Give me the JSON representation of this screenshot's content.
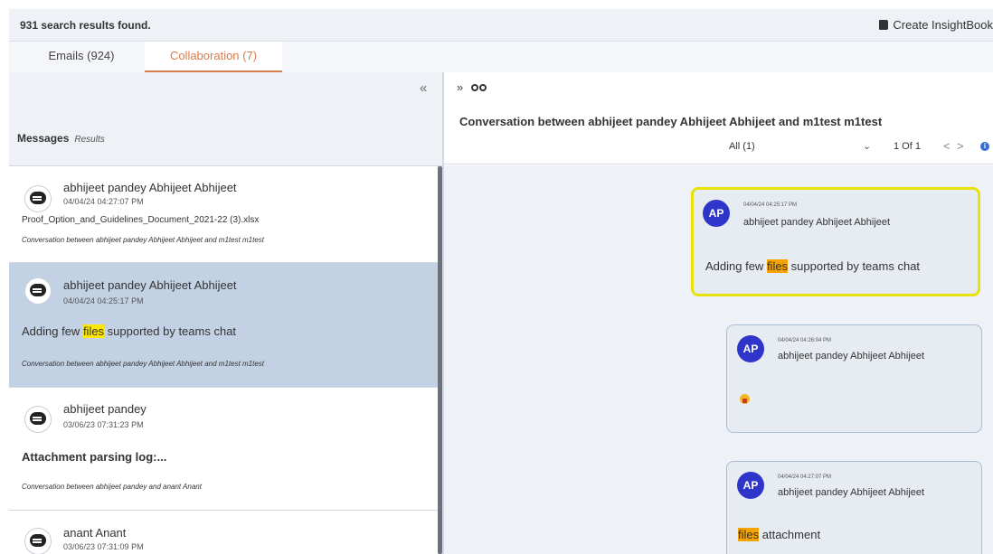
{
  "header": {
    "results_count": "931 search results found.",
    "create_button": "Create InsightBook",
    "icon": "book-icon"
  },
  "tabs": [
    {
      "label": "Emails (924)",
      "active": false
    },
    {
      "label": "Collaboration (7)",
      "active": true
    }
  ],
  "left_panel": {
    "collapse_icon": "double-chevron-left-icon",
    "collapse_glyph": "«",
    "messages_label": "Messages",
    "results_label": "Results",
    "items": [
      {
        "name": "abhijeet pandey Abhijeet Abhijeet",
        "time": "04/04/24 04:27:07 PM",
        "text": "Proof_Option_and_Guidelines_Document_2021-22 (3).xlsx",
        "conversation": "Conversation between abhijeet pandey Abhijeet Abhijeet and m1test m1test",
        "selected": false
      },
      {
        "name": "abhijeet pandey Abhijeet Abhijeet",
        "time": "04/04/24 04:25:17 PM",
        "text_before": "Adding few ",
        "text_highlight": "files",
        "text_after": " supported by teams chat",
        "conversation": "Conversation between abhijeet pandey Abhijeet Abhijeet and m1test m1test",
        "selected": true
      },
      {
        "name": "abhijeet pandey",
        "time": "03/06/23 07:31:23 PM",
        "text": "Attachment parsing log:...",
        "conversation": "Conversation between abhijeet pandey and anant Anant",
        "selected": false
      },
      {
        "name": "anant Anant",
        "time": "03/06/23 07:31:09 PM",
        "selected": false
      }
    ]
  },
  "right_panel": {
    "expand_glyph": "»",
    "expand_icon": "double-chevron-right-icon",
    "link_icon": "chain-link-icon",
    "conversation_title": "Conversation between abhijeet pandey Abhijeet Abhijeet and m1test m1test",
    "filter_value": "All (1)",
    "filter_chevron": "⌄",
    "page_info": "1 Of 1",
    "prev_glyph": "<",
    "next_glyph": ">",
    "info_glyph": "i",
    "messages": [
      {
        "avatar": "AP",
        "time": "04/04/24 04:25:17 PM",
        "sender": "abhijeet pandey Abhijeet Abhijeet",
        "text_before": "Adding few ",
        "text_highlight": "files",
        "text_after": " supported by teams chat",
        "highlighted": true
      },
      {
        "avatar": "AP",
        "time": "04/04/24 04:26:04 PM",
        "sender": "abhijeet pandey Abhijeet Abhijeet",
        "content_icon": "emoji-icon"
      },
      {
        "avatar": "AP",
        "time": "04/04/24 04:27:07 PM",
        "sender": "abhijeet pandey Abhijeet Abhijeet",
        "text_highlight": "files",
        "text_after": " attachment"
      }
    ]
  },
  "colors": {
    "accent": "#d97c49",
    "avatar": "#2f35c9",
    "highlight": "#ffe800",
    "highlight_orange": "#f7a400",
    "selected_row": "#c3d1e4"
  }
}
